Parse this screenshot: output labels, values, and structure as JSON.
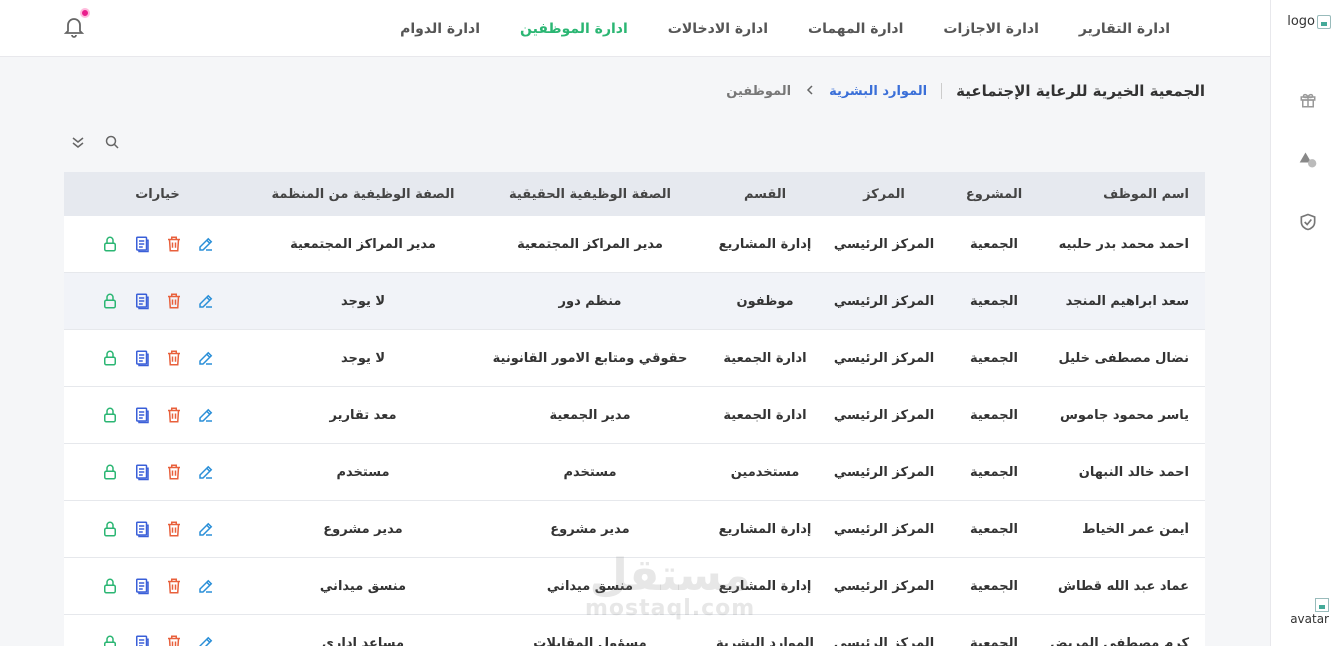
{
  "sidebar": {
    "logo_alt": "logo",
    "avatar_alt": "avatar"
  },
  "nav": {
    "items": [
      {
        "label": "ادارة الدوام",
        "active": false
      },
      {
        "label": "ادارة الموظفين",
        "active": true
      },
      {
        "label": "ادارة الادخالات",
        "active": false
      },
      {
        "label": "ادارة المهمات",
        "active": false
      },
      {
        "label": "ادارة الاجازات",
        "active": false
      },
      {
        "label": "ادارة التقارير",
        "active": false
      }
    ]
  },
  "breadcrumb": {
    "organization": "الجمعية الخيرية للرعاية الإجتماعية",
    "section": "الموارد البشرية",
    "current": "الموظفين"
  },
  "table": {
    "headers": {
      "name": "اسم الموظف",
      "project": "المشروع",
      "center": "المركز",
      "department": "القسم",
      "real_title": "الصفة الوظيفية الحقيقية",
      "org_title": "الصفة الوظيفية من المنظمة",
      "options": "خيارات"
    },
    "rows": [
      {
        "name": "احمد محمد بدر حلبيه",
        "project": "الجمعية",
        "center": "المركز الرئيسي",
        "department": "إدارة المشاريع",
        "real_title": "مدير المراكز المجتمعية",
        "org_title": "مدير المراكز المجتمعية"
      },
      {
        "name": "سعد ابراهيم المنجد",
        "project": "الجمعية",
        "center": "المركز الرئيسي",
        "department": "موظفون",
        "real_title": "منظم دور",
        "org_title": "لا يوجد"
      },
      {
        "name": "نضال مصطفى خليل",
        "project": "الجمعية",
        "center": "المركز الرئيسي",
        "department": "ادارة الجمعية",
        "real_title": "حقوقي ومتابع الامور القانونية",
        "org_title": "لا يوجد"
      },
      {
        "name": "ياسر محمود جاموس",
        "project": "الجمعية",
        "center": "المركز الرئيسي",
        "department": "ادارة الجمعية",
        "real_title": "مدير الجمعية",
        "org_title": "معد تقارير"
      },
      {
        "name": "احمد خالد النبهان",
        "project": "الجمعية",
        "center": "المركز الرئيسي",
        "department": "مستخدمين",
        "real_title": "مستخدم",
        "org_title": "مستخدم"
      },
      {
        "name": "أيمن عمر الخياط",
        "project": "الجمعية",
        "center": "المركز الرئيسي",
        "department": "إدارة المشاريع",
        "real_title": "مدير مشروع",
        "org_title": "مدير مشروع"
      },
      {
        "name": "عماد عبد الله قطاش",
        "project": "الجمعية",
        "center": "المركز الرئيسي",
        "department": "إدارة المشاريع",
        "real_title": "منسق ميداني",
        "org_title": "منسق ميداني"
      },
      {
        "name": "كرم مصطفى المريض",
        "project": "الجمعية",
        "center": "المركز الرئيسي",
        "department": "الموارد البشرية",
        "real_title": "مسؤول المقابلات",
        "org_title": "مساعد اداري"
      }
    ]
  },
  "watermark": {
    "arabic": "مستقل",
    "latin": "mostaql.com"
  },
  "colors": {
    "accent": "#2bb673",
    "link": "#3a6fd8",
    "edit": "#2a8fd8",
    "delete": "#e8603c",
    "report": "#3a5fd8",
    "lock": "#2bb673",
    "bell_dot": "#e91e8c"
  }
}
